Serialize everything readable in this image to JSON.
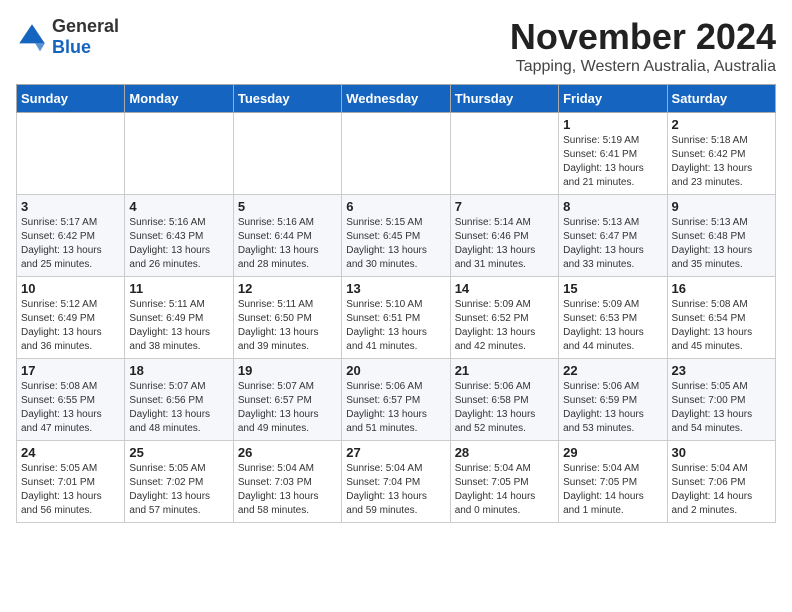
{
  "header": {
    "logo_general": "General",
    "logo_blue": "Blue",
    "month_title": "November 2024",
    "location": "Tapping, Western Australia, Australia"
  },
  "weekdays": [
    "Sunday",
    "Monday",
    "Tuesday",
    "Wednesday",
    "Thursday",
    "Friday",
    "Saturday"
  ],
  "weeks": [
    [
      {
        "day": "",
        "info": ""
      },
      {
        "day": "",
        "info": ""
      },
      {
        "day": "",
        "info": ""
      },
      {
        "day": "",
        "info": ""
      },
      {
        "day": "",
        "info": ""
      },
      {
        "day": "1",
        "info": "Sunrise: 5:19 AM\nSunset: 6:41 PM\nDaylight: 13 hours\nand 21 minutes."
      },
      {
        "day": "2",
        "info": "Sunrise: 5:18 AM\nSunset: 6:42 PM\nDaylight: 13 hours\nand 23 minutes."
      }
    ],
    [
      {
        "day": "3",
        "info": "Sunrise: 5:17 AM\nSunset: 6:42 PM\nDaylight: 13 hours\nand 25 minutes."
      },
      {
        "day": "4",
        "info": "Sunrise: 5:16 AM\nSunset: 6:43 PM\nDaylight: 13 hours\nand 26 minutes."
      },
      {
        "day": "5",
        "info": "Sunrise: 5:16 AM\nSunset: 6:44 PM\nDaylight: 13 hours\nand 28 minutes."
      },
      {
        "day": "6",
        "info": "Sunrise: 5:15 AM\nSunset: 6:45 PM\nDaylight: 13 hours\nand 30 minutes."
      },
      {
        "day": "7",
        "info": "Sunrise: 5:14 AM\nSunset: 6:46 PM\nDaylight: 13 hours\nand 31 minutes."
      },
      {
        "day": "8",
        "info": "Sunrise: 5:13 AM\nSunset: 6:47 PM\nDaylight: 13 hours\nand 33 minutes."
      },
      {
        "day": "9",
        "info": "Sunrise: 5:13 AM\nSunset: 6:48 PM\nDaylight: 13 hours\nand 35 minutes."
      }
    ],
    [
      {
        "day": "10",
        "info": "Sunrise: 5:12 AM\nSunset: 6:49 PM\nDaylight: 13 hours\nand 36 minutes."
      },
      {
        "day": "11",
        "info": "Sunrise: 5:11 AM\nSunset: 6:49 PM\nDaylight: 13 hours\nand 38 minutes."
      },
      {
        "day": "12",
        "info": "Sunrise: 5:11 AM\nSunset: 6:50 PM\nDaylight: 13 hours\nand 39 minutes."
      },
      {
        "day": "13",
        "info": "Sunrise: 5:10 AM\nSunset: 6:51 PM\nDaylight: 13 hours\nand 41 minutes."
      },
      {
        "day": "14",
        "info": "Sunrise: 5:09 AM\nSunset: 6:52 PM\nDaylight: 13 hours\nand 42 minutes."
      },
      {
        "day": "15",
        "info": "Sunrise: 5:09 AM\nSunset: 6:53 PM\nDaylight: 13 hours\nand 44 minutes."
      },
      {
        "day": "16",
        "info": "Sunrise: 5:08 AM\nSunset: 6:54 PM\nDaylight: 13 hours\nand 45 minutes."
      }
    ],
    [
      {
        "day": "17",
        "info": "Sunrise: 5:08 AM\nSunset: 6:55 PM\nDaylight: 13 hours\nand 47 minutes."
      },
      {
        "day": "18",
        "info": "Sunrise: 5:07 AM\nSunset: 6:56 PM\nDaylight: 13 hours\nand 48 minutes."
      },
      {
        "day": "19",
        "info": "Sunrise: 5:07 AM\nSunset: 6:57 PM\nDaylight: 13 hours\nand 49 minutes."
      },
      {
        "day": "20",
        "info": "Sunrise: 5:06 AM\nSunset: 6:57 PM\nDaylight: 13 hours\nand 51 minutes."
      },
      {
        "day": "21",
        "info": "Sunrise: 5:06 AM\nSunset: 6:58 PM\nDaylight: 13 hours\nand 52 minutes."
      },
      {
        "day": "22",
        "info": "Sunrise: 5:06 AM\nSunset: 6:59 PM\nDaylight: 13 hours\nand 53 minutes."
      },
      {
        "day": "23",
        "info": "Sunrise: 5:05 AM\nSunset: 7:00 PM\nDaylight: 13 hours\nand 54 minutes."
      }
    ],
    [
      {
        "day": "24",
        "info": "Sunrise: 5:05 AM\nSunset: 7:01 PM\nDaylight: 13 hours\nand 56 minutes."
      },
      {
        "day": "25",
        "info": "Sunrise: 5:05 AM\nSunset: 7:02 PM\nDaylight: 13 hours\nand 57 minutes."
      },
      {
        "day": "26",
        "info": "Sunrise: 5:04 AM\nSunset: 7:03 PM\nDaylight: 13 hours\nand 58 minutes."
      },
      {
        "day": "27",
        "info": "Sunrise: 5:04 AM\nSunset: 7:04 PM\nDaylight: 13 hours\nand 59 minutes."
      },
      {
        "day": "28",
        "info": "Sunrise: 5:04 AM\nSunset: 7:05 PM\nDaylight: 14 hours\nand 0 minutes."
      },
      {
        "day": "29",
        "info": "Sunrise: 5:04 AM\nSunset: 7:05 PM\nDaylight: 14 hours\nand 1 minute."
      },
      {
        "day": "30",
        "info": "Sunrise: 5:04 AM\nSunset: 7:06 PM\nDaylight: 14 hours\nand 2 minutes."
      }
    ]
  ]
}
